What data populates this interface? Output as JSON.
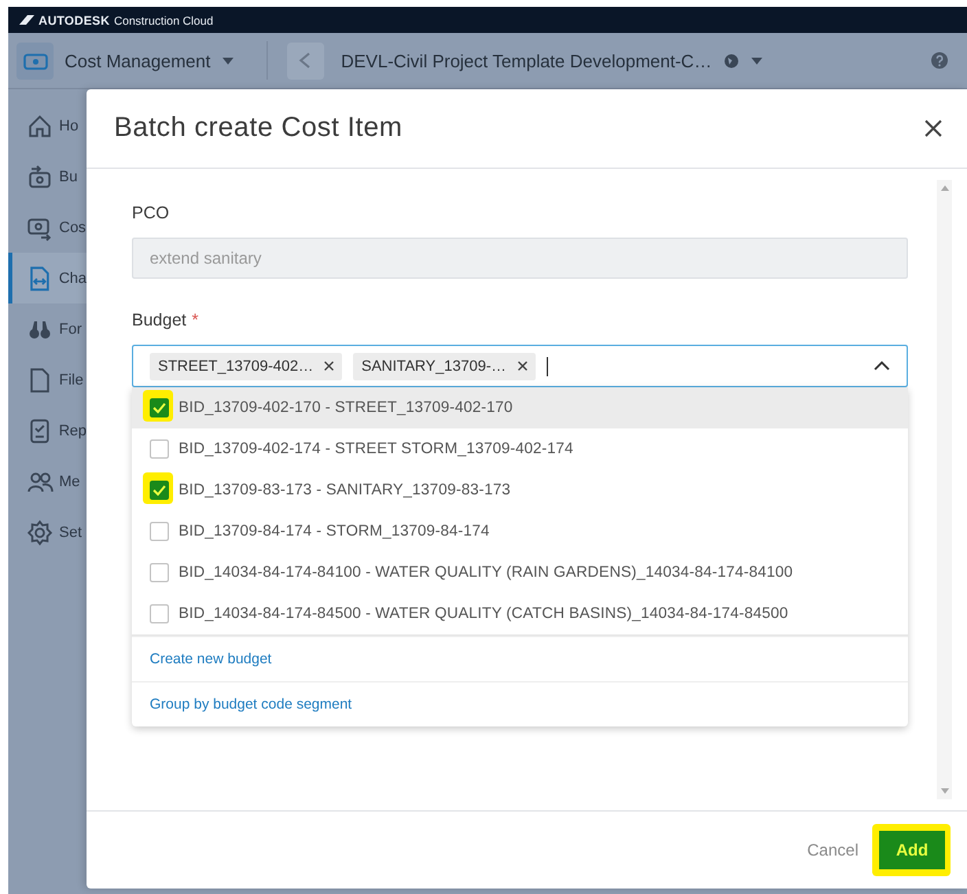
{
  "brand": {
    "logo": "AUTODESK",
    "product": "Construction Cloud"
  },
  "header": {
    "module": "Cost Management",
    "project": "DEVL-Civil Project Template Development-C…"
  },
  "sidebar": {
    "items": [
      {
        "label": "Ho",
        "selected": false
      },
      {
        "label": "Bu",
        "selected": false
      },
      {
        "label": "Cos",
        "selected": false
      },
      {
        "label": "Cha",
        "selected": true
      },
      {
        "label": "For",
        "selected": false
      },
      {
        "label": "File",
        "selected": false
      },
      {
        "label": "Rep",
        "selected": false
      },
      {
        "label": "Me",
        "selected": false
      },
      {
        "label": "Set",
        "selected": false
      }
    ]
  },
  "dialog": {
    "title": "Batch create Cost Item",
    "fields": [
      {
        "kind": "text",
        "label": "PCO",
        "value": "extend sanitary",
        "disabled": true
      },
      {
        "kind": "multiselect",
        "label": "Budget",
        "required_mark": "*",
        "tags": [
          "STREET_13709-402…",
          "SANITARY_13709-…"
        ],
        "expanded": true
      }
    ],
    "options": [
      {
        "label": "BID_13709-402-170 - STREET_13709-402-170",
        "checked": true,
        "hovered": true,
        "marked": true
      },
      {
        "label": "BID_13709-402-174 - STREET STORM_13709-402-174",
        "checked": false,
        "hovered": false,
        "marked": false
      },
      {
        "label": "BID_13709-83-173 - SANITARY_13709-83-173",
        "checked": true,
        "hovered": false,
        "marked": true
      },
      {
        "label": "BID_13709-84-174 - STORM_13709-84-174",
        "checked": false,
        "hovered": false,
        "marked": false
      },
      {
        "label": "BID_14034-84-174-84100 - WATER QUALITY (RAIN GARDENS)_14034-84-174-84100",
        "checked": false,
        "hovered": false,
        "marked": false
      },
      {
        "label": "BID_14034-84-174-84500 - WATER QUALITY (CATCH BASINS)_14034-84-174-84500",
        "checked": false,
        "hovered": false,
        "marked": false
      }
    ],
    "actions": [
      "Create new budget",
      "Group by budget code segment"
    ],
    "buttons": [
      {
        "label": "Cancel",
        "kind": "secondary",
        "marked": false
      },
      {
        "label": "Add",
        "kind": "primary",
        "marked": true
      }
    ]
  }
}
